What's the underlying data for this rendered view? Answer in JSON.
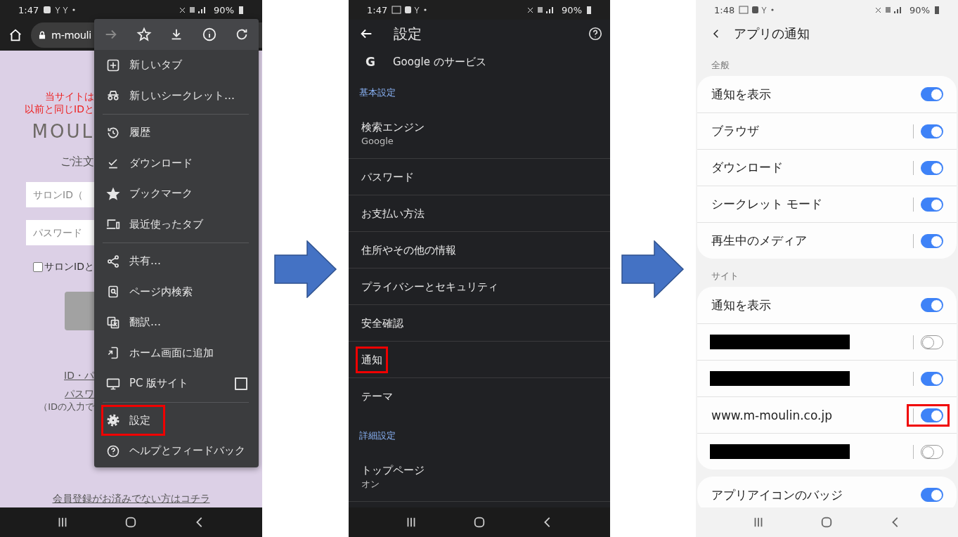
{
  "left_phone": {
    "status": {
      "time": "1:47",
      "battery": "90%"
    },
    "address": {
      "text": "m-mouli"
    },
    "page": {
      "notice": [
        "当サイトは",
        "以前と同じIDと"
      ],
      "logo": "MOUL",
      "heading": "ご注文",
      "fields": [
        {
          "placeholder": "サロンID（"
        },
        {
          "placeholder": "パスワード"
        }
      ],
      "remember": {
        "label": "サロンIDと",
        "checked": false
      },
      "links": [
        "ID・パ",
        "パスワ"
      ],
      "note": "（IDの入力で",
      "register_link": "会員登録がお済みでない方はコチラ"
    },
    "menu": {
      "toolbar": [
        {
          "kind": "forward",
          "disabled": true
        },
        {
          "kind": "bookmark",
          "disabled": false
        },
        {
          "kind": "download",
          "disabled": false
        },
        {
          "kind": "info",
          "disabled": false
        },
        {
          "kind": "refresh",
          "disabled": false
        }
      ],
      "groups": [
        {
          "items": [
            {
              "kind": "new-tab",
              "label": "新しいタブ",
              "highlighted": false
            },
            {
              "kind": "incognito",
              "label": "新しいシークレット…",
              "highlighted": false
            }
          ]
        },
        {
          "items": [
            {
              "kind": "history",
              "label": "履歴",
              "highlighted": false
            },
            {
              "kind": "downloads",
              "label": "ダウンロード",
              "highlighted": false
            },
            {
              "kind": "bookmarks",
              "label": "ブックマーク",
              "highlighted": false
            },
            {
              "kind": "recent-tabs",
              "label": "最近使ったタブ",
              "highlighted": false
            }
          ]
        },
        {
          "items": [
            {
              "kind": "share",
              "label": "共有…",
              "highlighted": false
            },
            {
              "kind": "find",
              "label": "ページ内検索",
              "highlighted": false
            },
            {
              "kind": "translate",
              "label": "翻訳…",
              "highlighted": false
            },
            {
              "kind": "add-home",
              "label": "ホーム画面に追加",
              "highlighted": false
            },
            {
              "kind": "desktop",
              "label": "PC 版サイト",
              "highlighted": false,
              "checked": false
            }
          ]
        },
        {
          "items": [
            {
              "kind": "settings",
              "label": "設定",
              "highlighted": true
            },
            {
              "kind": "help",
              "label": "ヘルプとフィードバック",
              "highlighted": false
            }
          ]
        }
      ]
    }
  },
  "middle_phone": {
    "status": {
      "time": "1:47",
      "battery": "90%"
    },
    "title": "設定",
    "rows": [
      {
        "kind": "service",
        "logo": "G",
        "label": "Google のサービス"
      },
      {
        "kind": "section",
        "label": "基本設定"
      },
      {
        "kind": "item",
        "label": "検索エンジン",
        "sublabel": "Google",
        "highlighted": false
      },
      {
        "kind": "item",
        "label": "パスワード",
        "highlighted": false
      },
      {
        "kind": "item",
        "label": "お支払い方法",
        "highlighted": false
      },
      {
        "kind": "item",
        "label": "住所やその他の情報",
        "highlighted": false
      },
      {
        "kind": "item",
        "label": "プライバシーとセキュリティ",
        "highlighted": false
      },
      {
        "kind": "item",
        "label": "安全確認",
        "highlighted": false
      },
      {
        "kind": "item",
        "label": "通知",
        "highlighted": true
      },
      {
        "kind": "item",
        "label": "テーマ",
        "highlighted": false
      },
      {
        "kind": "section",
        "label": "詳細設定"
      },
      {
        "kind": "item",
        "label": "トップページ",
        "sublabel": "オン",
        "highlighted": false
      }
    ]
  },
  "right_phone": {
    "status": {
      "time": "1:48",
      "battery": "90%"
    },
    "title": "アプリの通知",
    "cards": [
      {
        "title": "全般",
        "rows": [
          {
            "kind": "text",
            "label": "通知を表示",
            "on": true,
            "highlighted": false
          },
          {
            "kind": "text",
            "label": "ブラウザ",
            "on": true,
            "highlighted": false
          },
          {
            "kind": "text",
            "label": "ダウンロード",
            "on": true,
            "highlighted": false
          },
          {
            "kind": "text",
            "label": "シークレット モード",
            "on": true,
            "highlighted": false
          },
          {
            "kind": "text",
            "label": "再生中のメディア",
            "on": true,
            "highlighted": false
          }
        ]
      },
      {
        "title": "サイト",
        "rows": [
          {
            "kind": "text",
            "label": "通知を表示",
            "on": true,
            "highlighted": false
          },
          {
            "kind": "redacted",
            "on": false,
            "highlighted": false
          },
          {
            "kind": "redacted",
            "on": true,
            "highlighted": false
          },
          {
            "kind": "text",
            "label": "www.m-moulin.co.jp",
            "on": true,
            "highlighted": true
          },
          {
            "kind": "redacted",
            "on": false,
            "highlighted": false
          }
        ]
      },
      {
        "rows": [
          {
            "kind": "text",
            "label": "アプリアイコンのバッジ",
            "on": true,
            "highlighted": false
          }
        ]
      }
    ]
  }
}
